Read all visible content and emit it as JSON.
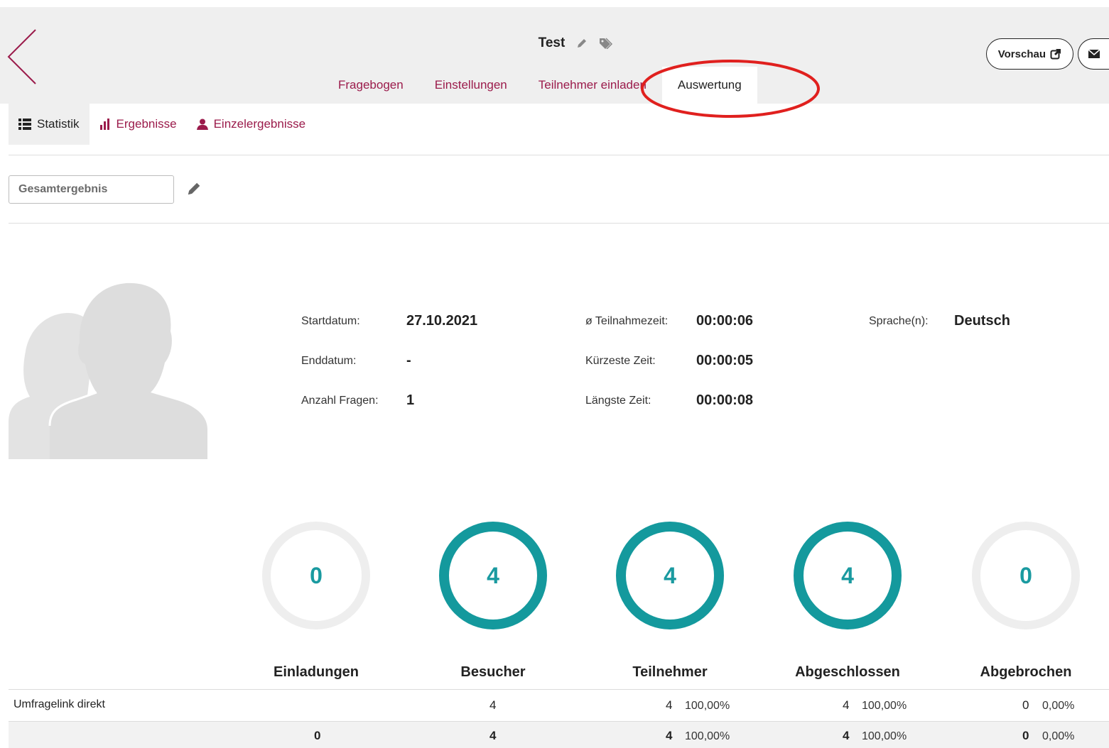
{
  "header": {
    "title": "Test",
    "tabs": [
      {
        "label": "Fragebogen"
      },
      {
        "label": "Einstellungen"
      },
      {
        "label": "Teilnehmer einladen"
      },
      {
        "label": "Auswertung"
      }
    ],
    "preview_label": "Vorschau"
  },
  "subnav": [
    {
      "label": "Statistik"
    },
    {
      "label": "Ergebnisse"
    },
    {
      "label": "Einzelergebnisse"
    }
  ],
  "filter": {
    "placeholder": "Gesamtergebnis"
  },
  "info": {
    "start_label": "Startdatum:",
    "start_value": "27.10.2021",
    "end_label": "Enddatum:",
    "end_value": "-",
    "questions_label": "Anzahl Fragen:",
    "questions_value": "1",
    "avg_label": "ø Teilnahmezeit:",
    "avg_value": "00:00:06",
    "shortest_label": "Kürzeste Zeit:",
    "shortest_value": "00:00:05",
    "longest_label": "Längste Zeit:",
    "longest_value": "00:00:08",
    "lang_label": "Sprache(n):",
    "lang_value": "Deutsch"
  },
  "stats": {
    "circles": [
      "0",
      "4",
      "4",
      "4",
      "0"
    ],
    "columns": [
      "Einladungen",
      "Besucher",
      "Teilnehmer",
      "Abgeschlossen",
      "Abgebrochen"
    ],
    "rows": [
      {
        "label": "Umfragelink direkt",
        "einladungen": "",
        "besucher": "4",
        "teilnehmer": "4",
        "teilnehmer_pct": "100,00%",
        "abgeschlossen": "4",
        "abgeschlossen_pct": "100,00%",
        "abgebrochen": "0",
        "abgebrochen_pct": "0,00%"
      }
    ],
    "total": {
      "einladungen": "0",
      "besucher": "4",
      "teilnehmer": "4",
      "teilnehmer_pct": "100,00%",
      "abgeschlossen": "4",
      "abgeschlossen_pct": "100,00%",
      "abgebrochen": "0",
      "abgebrochen_pct": "0,00%"
    }
  },
  "colors": {
    "accent": "#9b1b4b",
    "teal": "#14999d",
    "highlight": "#e0201e",
    "header_bg": "#efefef"
  }
}
